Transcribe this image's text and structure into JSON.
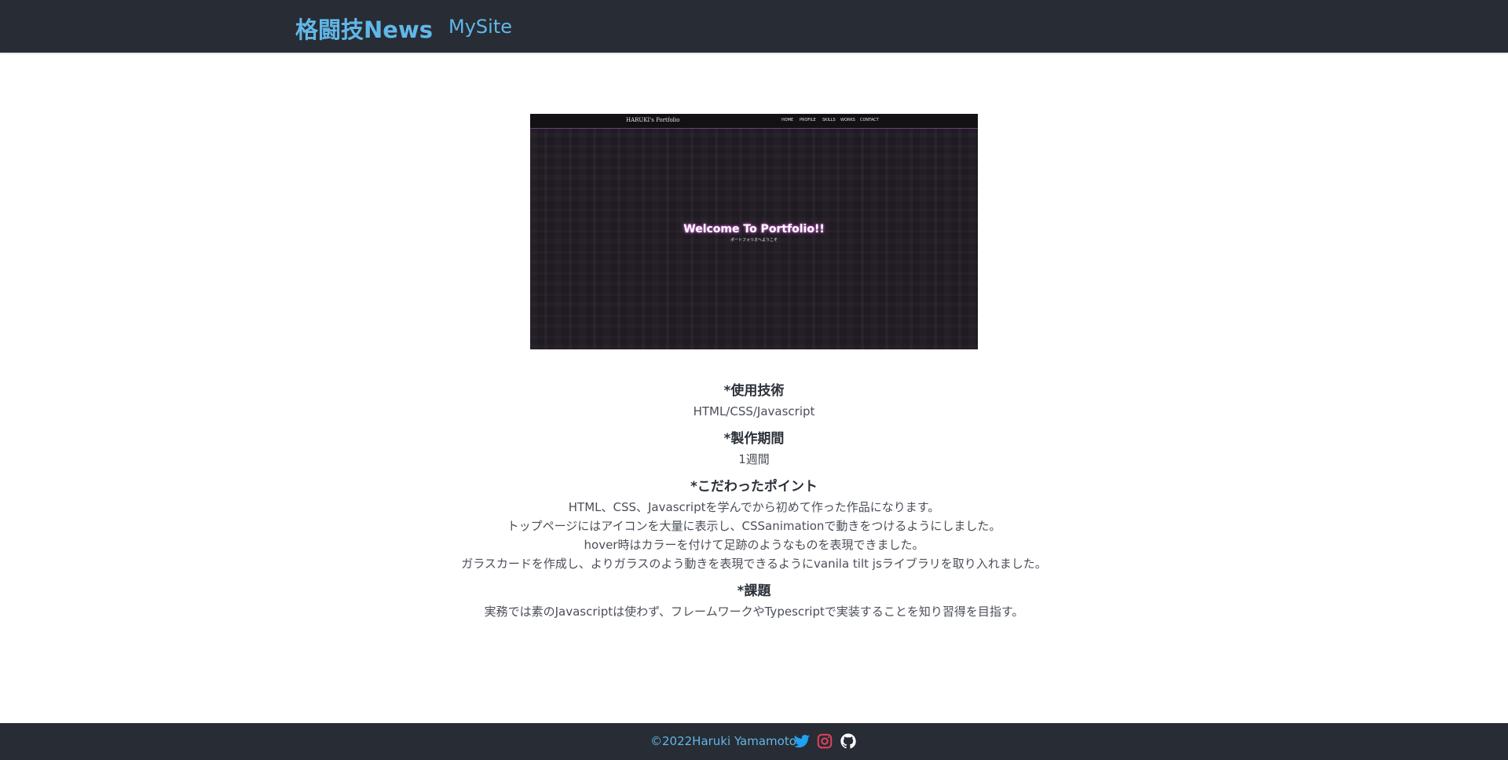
{
  "header": {
    "brand": "格闘技News",
    "nav_link": "MySite"
  },
  "screenshot_preview": {
    "logo_text": "HARUKI's Portfolio",
    "menu": [
      "HOME",
      "PROFILE",
      "SKILLS",
      "WORKS",
      "CONTACT"
    ],
    "title": "Welcome To Portfolio!!",
    "subtitle": "ポートフォリオへようこそ"
  },
  "main": {
    "sections": {
      "tech": {
        "heading": "*使用技術",
        "body": "HTML/CSS/Javascript"
      },
      "period": {
        "heading": "*製作期間",
        "body": "1週間"
      },
      "points": {
        "heading": "*こだわったポイント",
        "lines": [
          "HTML、CSS、Javascriptを学んでから初めて作った作品になります。",
          "トップページにはアイコンを大量に表示し、CSSanimationで動きをつけるようにしました。",
          "hover時はカラーを付けて足跡のようなものを表現できました。",
          "ガラスカードを作成し、よりガラスのよう動きを表現できるようにvanila tilt jsライブラリを取り入れました。"
        ]
      },
      "task": {
        "heading": "*課題",
        "body": "実務では素のJavascriptは使わず、フレームワークやTypescriptで実装することを知り習得を目指す。"
      }
    }
  },
  "footer": {
    "copyright": "©2022Haruki Yamamoto",
    "social_icons": [
      "twitter-icon",
      "instagram-icon",
      "github-icon"
    ]
  },
  "colors": {
    "nav_background": "#282c34",
    "accent": "#61b7e8",
    "twitter": "#1da1f2",
    "instagram": "#e4405f",
    "github": "#ffffff"
  }
}
